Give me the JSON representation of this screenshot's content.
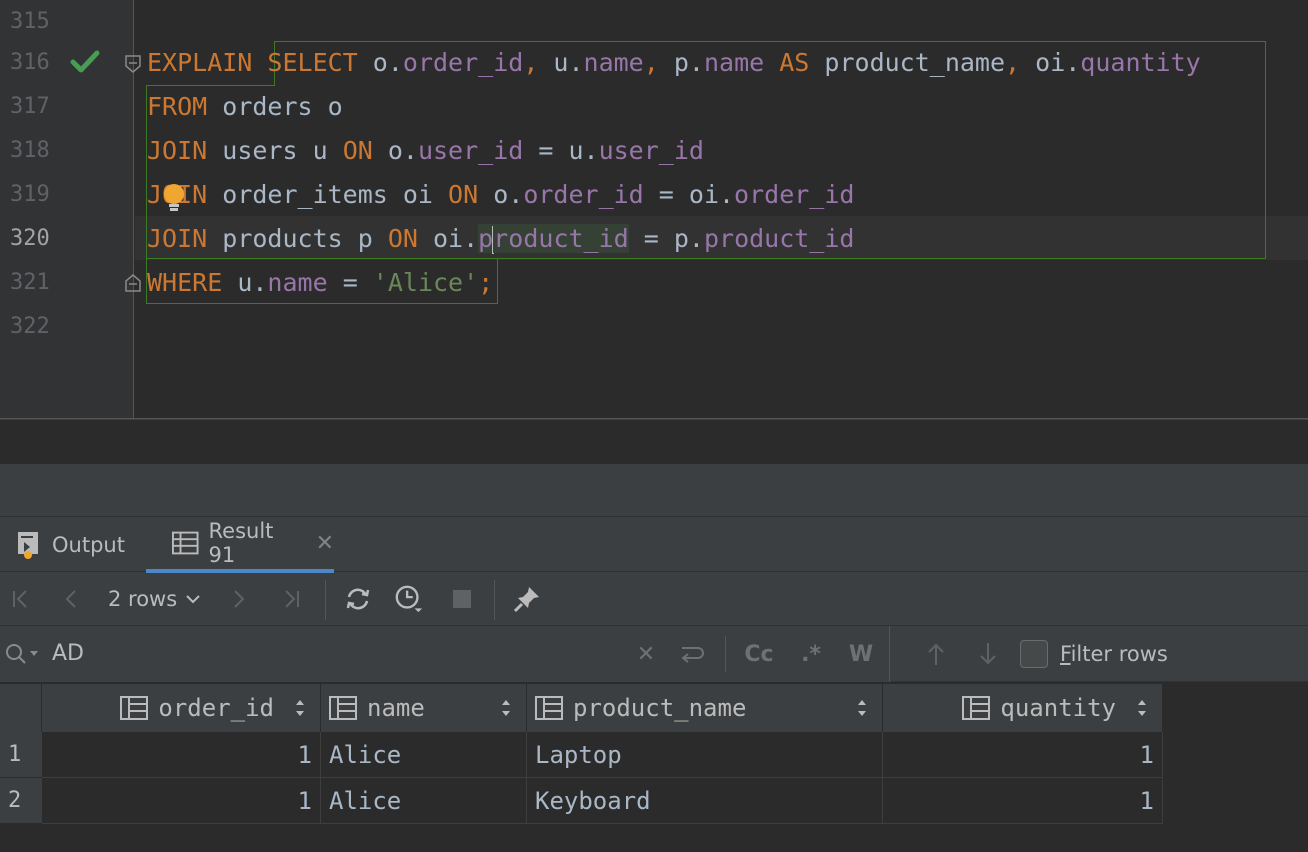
{
  "editor": {
    "line_numbers": [
      "315",
      "316",
      "317",
      "318",
      "319",
      "320",
      "321",
      "322"
    ],
    "lines": {
      "l316": [
        {
          "t": "EXPLAIN",
          "c": "kw"
        },
        {
          "t": " ",
          "c": "pl"
        },
        {
          "t": "SELECT",
          "c": "kw"
        },
        {
          "t": " o.",
          "c": "pl"
        },
        {
          "t": "order_id",
          "c": "fld"
        },
        {
          "t": ", ",
          "c": "sc"
        },
        {
          "t": "u.",
          "c": "pl"
        },
        {
          "t": "name",
          "c": "fld"
        },
        {
          "t": ", ",
          "c": "sc"
        },
        {
          "t": "p.",
          "c": "pl"
        },
        {
          "t": "name",
          "c": "fld"
        },
        {
          "t": " ",
          "c": "pl"
        },
        {
          "t": "AS",
          "c": "kw"
        },
        {
          "t": " product_name",
          "c": "pl"
        },
        {
          "t": ", ",
          "c": "sc"
        },
        {
          "t": "oi.",
          "c": "pl"
        },
        {
          "t": "quantity",
          "c": "fld"
        }
      ],
      "l317": [
        {
          "t": "FROM",
          "c": "kw"
        },
        {
          "t": " orders o",
          "c": "pl"
        }
      ],
      "l318": [
        {
          "t": "JOIN",
          "c": "kw"
        },
        {
          "t": " users u ",
          "c": "pl"
        },
        {
          "t": "ON",
          "c": "kw"
        },
        {
          "t": " o.",
          "c": "pl"
        },
        {
          "t": "user_id",
          "c": "fld"
        },
        {
          "t": " = u.",
          "c": "pl"
        },
        {
          "t": "user_id",
          "c": "fld"
        }
      ],
      "l319": [
        {
          "t": "JOIN",
          "c": "kw"
        },
        {
          "t": " order_items oi ",
          "c": "pl"
        },
        {
          "t": "ON",
          "c": "kw"
        },
        {
          "t": " o.",
          "c": "pl"
        },
        {
          "t": "order_id",
          "c": "fld"
        },
        {
          "t": " = oi.",
          "c": "pl"
        },
        {
          "t": "order_id",
          "c": "fld"
        }
      ],
      "l320": [
        {
          "t": "JOIN",
          "c": "kw"
        },
        {
          "t": " products p ",
          "c": "pl"
        },
        {
          "t": "ON",
          "c": "kw"
        },
        {
          "t": " oi.",
          "c": "pl"
        },
        {
          "t": "p",
          "c": "fld hl"
        },
        {
          "t": "CARET",
          "c": "caret"
        },
        {
          "t": "roduct_id",
          "c": "fld hl"
        },
        {
          "t": " = p.",
          "c": "pl"
        },
        {
          "t": "product_id",
          "c": "fld"
        }
      ],
      "l321": [
        {
          "t": "WHERE",
          "c": "kw"
        },
        {
          "t": " u.",
          "c": "pl"
        },
        {
          "t": "name",
          "c": "fld"
        },
        {
          "t": " = ",
          "c": "pl"
        },
        {
          "t": "'Alice'",
          "c": "str"
        },
        {
          "t": ";",
          "c": "sc"
        }
      ]
    }
  },
  "tabs": {
    "output_label": "Output",
    "result_label": "Result 91",
    "close_glyph": "✕"
  },
  "toolbar": {
    "rows_label": "2 rows"
  },
  "search": {
    "value": "AD",
    "clear_glyph": "✕",
    "case_label": "Cc",
    "regex_label": ".*",
    "word_label": "W",
    "filter_label_underlined": "F",
    "filter_label_rest": "ilter rows"
  },
  "grid": {
    "columns": [
      "order_id",
      "name",
      "product_name",
      "quantity"
    ],
    "row_numbers": [
      "1",
      "2"
    ],
    "rows": [
      [
        "1",
        "Alice",
        "Laptop",
        "1"
      ],
      [
        "1",
        "Alice",
        "Keyboard",
        "1"
      ]
    ]
  },
  "colors": {
    "keyword": "#cc7832",
    "field": "#9876aa",
    "string": "#6a8759",
    "check_green": "#499c54",
    "selection_border": "#3d7a26",
    "tab_underline": "#4a88c7"
  },
  "icons": [
    "check-icon",
    "bulb-icon",
    "fold-icon",
    "output-icon",
    "table-icon",
    "first-page-icon",
    "prev-page-icon",
    "next-page-icon",
    "last-page-icon",
    "refresh-icon",
    "history-icon",
    "stop-icon",
    "pin-icon",
    "search-icon",
    "close-icon",
    "replace-icon",
    "arrow-up-icon",
    "arrow-down-icon",
    "sort-icon"
  ]
}
